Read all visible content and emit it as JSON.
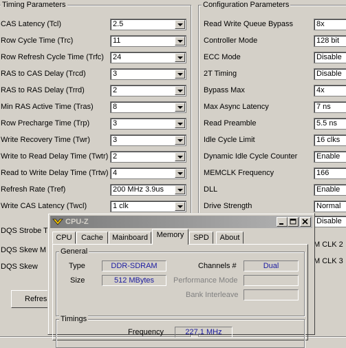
{
  "timing": {
    "title": "Timing Parameters",
    "rows": [
      {
        "label": "CAS Latency (Tcl)",
        "value": "2.5"
      },
      {
        "label": "Row Cycle Time (Trc)",
        "value": "11"
      },
      {
        "label": "Row Refresh Cycle Time (Trfc)",
        "value": "24"
      },
      {
        "label": "RAS to CAS Delay (Trcd)",
        "value": "3"
      },
      {
        "label": "RAS to RAS Delay (Trrd)",
        "value": "2"
      },
      {
        "label": "Min RAS Active Time (Tras)",
        "value": "8"
      },
      {
        "label": "Row Precharge Time (Trp)",
        "value": "3"
      },
      {
        "label": "Write Recovery Time (Twr)",
        "value": "3"
      },
      {
        "label": "Write to Read Delay Time (Twtr)",
        "value": "2"
      },
      {
        "label": "Read to Write Delay Time (Trtw)",
        "value": "4"
      },
      {
        "label": "Refresh Rate (Tref)",
        "value": "200 MHz 3.9us"
      },
      {
        "label": "Write CAS Latency (Twcl)",
        "value": "1 clk"
      }
    ],
    "extra_labels": [
      "DQS Strobe T",
      "DQS Skew M",
      "DQS Skew"
    ],
    "refresh_button": "Refres"
  },
  "config": {
    "title": "Configuration Parameters",
    "rows": [
      {
        "label": "Read Write Queue Bypass",
        "value": "8x"
      },
      {
        "label": "Controller Mode",
        "value": "128 bit"
      },
      {
        "label": "ECC Mode",
        "value": "Disable"
      },
      {
        "label": "2T Timing",
        "value": "Disable"
      },
      {
        "label": "Bypass Max",
        "value": "4x"
      },
      {
        "label": "Max Async Latency",
        "value": "7 ns"
      },
      {
        "label": "Read Preamble",
        "value": "5.5 ns"
      },
      {
        "label": "Idle Cycle Limit",
        "value": "16 clks"
      },
      {
        "label": "Dynamic Idle Cycle Counter",
        "value": "Enable"
      },
      {
        "label": "MEMCLK Frequency",
        "value": "166"
      },
      {
        "label": "DLL",
        "value": "Enable"
      },
      {
        "label": "Drive Strength",
        "value": "Normal"
      }
    ],
    "extra_value": "Disable",
    "extra_labels": [
      "M CLK 2",
      "M CLK 3"
    ]
  },
  "cpuz": {
    "title": "CPU-Z",
    "tabs": [
      "CPU",
      "Cache",
      "Mainboard",
      "Memory",
      "SPD",
      "About"
    ],
    "active_tab": "Memory",
    "general": {
      "title": "General",
      "type_label": "Type",
      "type_value": "DDR-SDRAM",
      "size_label": "Size",
      "size_value": "512 MBytes",
      "channels_label": "Channels #",
      "channels_value": "Dual",
      "perf_mode_label": "Performance Mode",
      "perf_mode_value": "",
      "bank_label": "Bank Interleave",
      "bank_value": ""
    },
    "timings": {
      "title": "Timings",
      "frequency_label": "Frequency",
      "frequency_value": "227.1 MHz"
    }
  }
}
